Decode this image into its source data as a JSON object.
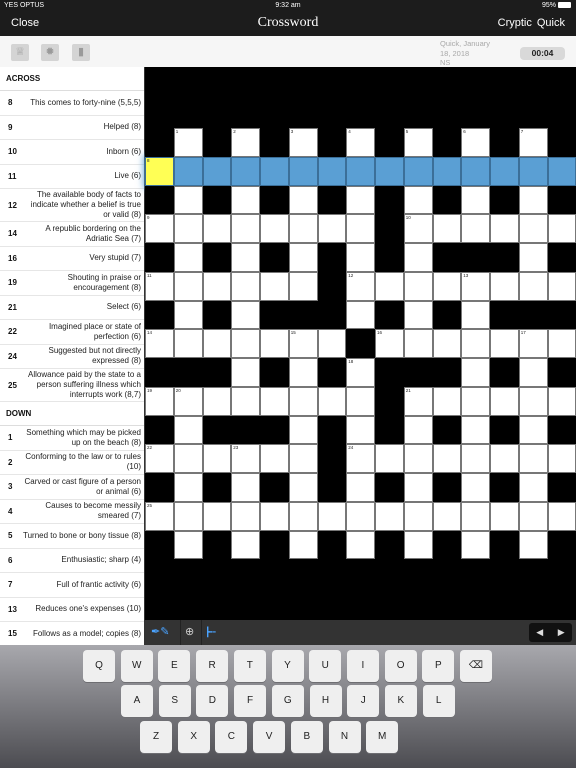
{
  "status": {
    "carrier": "YES OPTUS",
    "time": "9:32 am",
    "battery": "95%"
  },
  "nav": {
    "close": "Close",
    "title": "Crossword",
    "modes": [
      "Cryptic",
      "Quick"
    ]
  },
  "toolbar": {
    "icons": [
      "trophy-icon",
      "hint-lightbulb-icon",
      "trash-icon"
    ],
    "info": [
      "Quick, January",
      "18, 2018",
      "NS"
    ],
    "timer": "00:04"
  },
  "clues": {
    "across_label": "ACROSS",
    "across": [
      {
        "n": "8",
        "t": "This comes to forty-nine (5,5,5)"
      },
      {
        "n": "9",
        "t": "Helped (8)"
      },
      {
        "n": "10",
        "t": "Inborn (6)"
      },
      {
        "n": "11",
        "t": "Live (6)"
      },
      {
        "n": "12",
        "t": "The available body of facts to indicate whether a belief is true or valid (8)"
      },
      {
        "n": "14",
        "t": "A republic bordering on the Adriatic Sea (7)"
      },
      {
        "n": "16",
        "t": "Very stupid (7)"
      },
      {
        "n": "19",
        "t": "Shouting in praise or encouragement (8)"
      },
      {
        "n": "21",
        "t": "Select (6)"
      },
      {
        "n": "22",
        "t": "Imagined place or state of perfection (6)"
      },
      {
        "n": "24",
        "t": "Suggested but not directly expressed (8)"
      },
      {
        "n": "25",
        "t": "Allowance paid by the state to a person suffering illness which interrupts work (8,7)"
      }
    ],
    "down_label": "DOWN",
    "down": [
      {
        "n": "1",
        "t": "Something which may be picked up on the beach (8)"
      },
      {
        "n": "2",
        "t": "Conforming to the law or to rules (10)"
      },
      {
        "n": "3",
        "t": "Carved or cast figure of a person or animal (6)"
      },
      {
        "n": "4",
        "t": "Causes to become messily smeared (7)"
      },
      {
        "n": "5",
        "t": "Turned to bone or bony tissue (8)"
      },
      {
        "n": "6",
        "t": "Enthusiastic; sharp (4)"
      },
      {
        "n": "7",
        "t": "Full of frantic activity (6)"
      },
      {
        "n": "13",
        "t": "Reduces one's expenses (10)"
      },
      {
        "n": "15",
        "t": "Follows as a model; copies (8)"
      }
    ]
  },
  "grid": {
    "rows": [
      "#.#.#.#.#.#.#.#",
      "...............",
      "#.#.#.#.#.#.#.#",
      "........#......",
      "#.#.#.#.#.###.#",
      "......#........",
      "#.#.###.#.#.###",
      ".......#.......",
      "###.#.#.###.#.#",
      "........#......",
      "#.###.#.#.#.#.#",
      "......#........",
      "#.#.#.#.#.#.#.#",
      "...............",
      "#.#.#.#.#.#.#.#"
    ],
    "numbers": [
      [
        0,
        1,
        "1"
      ],
      [
        0,
        3,
        "2"
      ],
      [
        0,
        5,
        "3"
      ],
      [
        0,
        7,
        "4"
      ],
      [
        0,
        9,
        "5"
      ],
      [
        0,
        11,
        "6"
      ],
      [
        0,
        13,
        "7"
      ],
      [
        1,
        0,
        "8"
      ],
      [
        3,
        0,
        "9"
      ],
      [
        3,
        9,
        "10"
      ],
      [
        5,
        0,
        "11"
      ],
      [
        5,
        7,
        "12"
      ],
      [
        5,
        11,
        "13"
      ],
      [
        7,
        0,
        "14"
      ],
      [
        7,
        5,
        "15"
      ],
      [
        7,
        8,
        "16"
      ],
      [
        7,
        13,
        "17"
      ],
      [
        8,
        7,
        "18"
      ],
      [
        9,
        0,
        "19"
      ],
      [
        9,
        1,
        "20"
      ],
      [
        9,
        9,
        "21"
      ],
      [
        11,
        0,
        "22"
      ],
      [
        11,
        3,
        "23"
      ],
      [
        11,
        7,
        "24"
      ],
      [
        13,
        0,
        "25"
      ]
    ],
    "highlight_row": 1,
    "selected_cell": [
      1,
      0
    ],
    "colors": {
      "highlight": "#5a9fd4",
      "selected": "#ffff55"
    }
  },
  "bottombar": {
    "icons": [
      "pen-pencil-icon",
      "zoom-icon",
      "clue-list-icon",
      "prev-arrow-icon",
      "next-arrow-icon"
    ]
  },
  "keyboard": {
    "rows": [
      [
        "Q",
        "W",
        "E",
        "R",
        "T",
        "Y",
        "U",
        "I",
        "O",
        "P"
      ],
      [
        "A",
        "S",
        "D",
        "F",
        "G",
        "H",
        "J",
        "K",
        "L"
      ],
      [
        "Z",
        "X",
        "C",
        "V",
        "B",
        "N",
        "M"
      ]
    ]
  }
}
